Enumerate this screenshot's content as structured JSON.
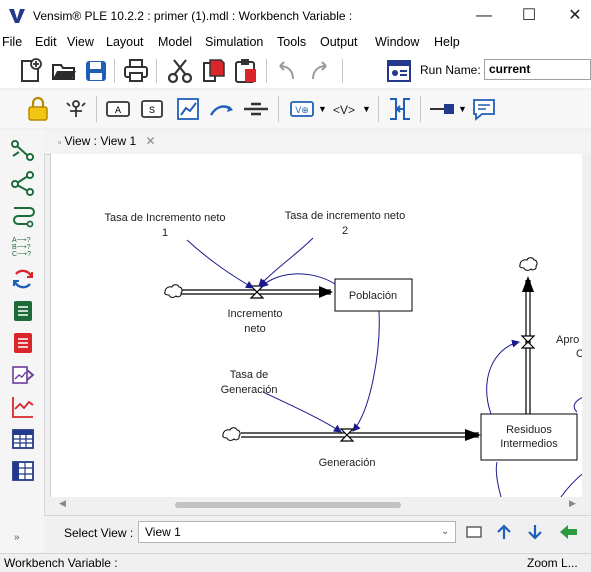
{
  "window": {
    "title": "Vensim® PLE 10.2.2 : primer (1).mdl : Workbench Variable :",
    "minimize_glyph": "—",
    "maximize_glyph": "☐",
    "close_glyph": "✕"
  },
  "menu": [
    "File",
    "Edit",
    "View",
    "Layout",
    "Model",
    "Simulation",
    "Tools",
    "Output",
    "Window",
    "Help"
  ],
  "toolbar": {
    "run_name_label": "Run Name:",
    "run_name_value": "current"
  },
  "view_tab": {
    "label": "View : View 1",
    "close_glyph": "✕"
  },
  "diagram": {
    "labels": {
      "tasa_inc_1": [
        "Tasa de Incremento neto",
        "1"
      ],
      "tasa_inc_2": [
        "Tasa de incremento neto",
        "2"
      ],
      "poblacion": "Población",
      "incremento_neto": [
        "Incremento",
        "neto"
      ],
      "tasa_generacion": [
        "Tasa de",
        "Generación"
      ],
      "generacion": "Generación",
      "residuos": [
        "Residuos",
        "Intermedios"
      ],
      "apro": [
        "Apro",
        "C"
      ]
    }
  },
  "bottom": {
    "select_view_label": "Select View :",
    "select_view_value": "View 1"
  },
  "status": {
    "left": "Workbench Variable :",
    "right": "Zoom L..."
  },
  "colors": {
    "accent_blue": "#1f5fb8",
    "link_navy": "#1a1a8c",
    "lock_yellow": "#f3c614",
    "red_icon": "#d9262b"
  },
  "icons": [
    "vensim-logo-icon",
    "new-icon",
    "open-icon",
    "save-icon",
    "print-icon",
    "cut-icon",
    "copy-icon",
    "paste-icon",
    "undo-icon",
    "redo-icon",
    "run-settings-icon",
    "lock-icon",
    "move-icon",
    "variable-icon",
    "box-icon",
    "arrow-icon",
    "rate-icon",
    "shadow-icon",
    "input-output-icon",
    "comment-icon"
  ]
}
